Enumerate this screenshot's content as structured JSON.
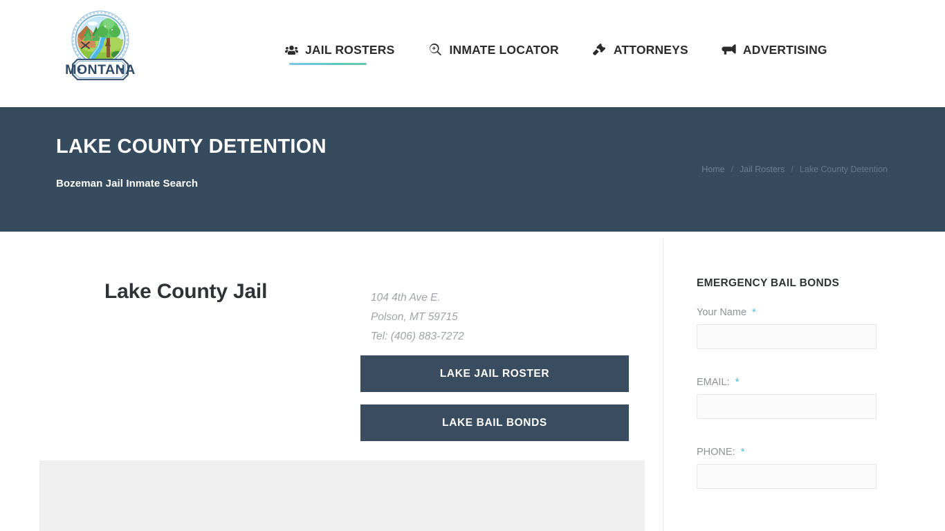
{
  "header": {
    "logo": {
      "name": "montana-logo",
      "banner_text": "MONTANA"
    },
    "nav": [
      {
        "label": "JAIL ROSTERS",
        "icon": "users-icon",
        "active": true
      },
      {
        "label": "INMATE LOCATOR",
        "icon": "search-icon",
        "active": false
      },
      {
        "label": "ATTORNEYS",
        "icon": "gavel-icon",
        "active": false
      },
      {
        "label": "ADVERTISING",
        "icon": "bullhorn-icon",
        "active": false
      }
    ]
  },
  "hero": {
    "title": "LAKE COUNTY DETENTION",
    "subtitle": "Bozeman Jail Inmate Search",
    "background_color": "#374b5f",
    "breadcrumb": [
      {
        "label": "Home",
        "current": false
      },
      {
        "label": "Jail Rosters",
        "current": false
      },
      {
        "label": "Lake County Detention",
        "current": true
      }
    ],
    "breadcrumb_separator": "/"
  },
  "main": {
    "jail_name": "Lake County Jail",
    "address": {
      "line1": "104 4th Ave E.",
      "line2": "Polson, MT 59715",
      "phone": "Tel: (406) 883-7272"
    },
    "buttons": [
      {
        "label": "LAKE JAIL ROSTER"
      },
      {
        "label": "LAKE BAIL BONDS"
      }
    ],
    "button_color": "#394c60"
  },
  "sidebar": {
    "widget_title": "EMERGENCY BAIL BONDS",
    "required_marker": "*",
    "accent_color": "#4cc3e0",
    "fields": [
      {
        "label": "Your Name",
        "value": "",
        "placeholder": ""
      },
      {
        "label": "EMAIL:",
        "value": "",
        "placeholder": ""
      },
      {
        "label": "PHONE:",
        "value": "",
        "placeholder": ""
      }
    ]
  }
}
